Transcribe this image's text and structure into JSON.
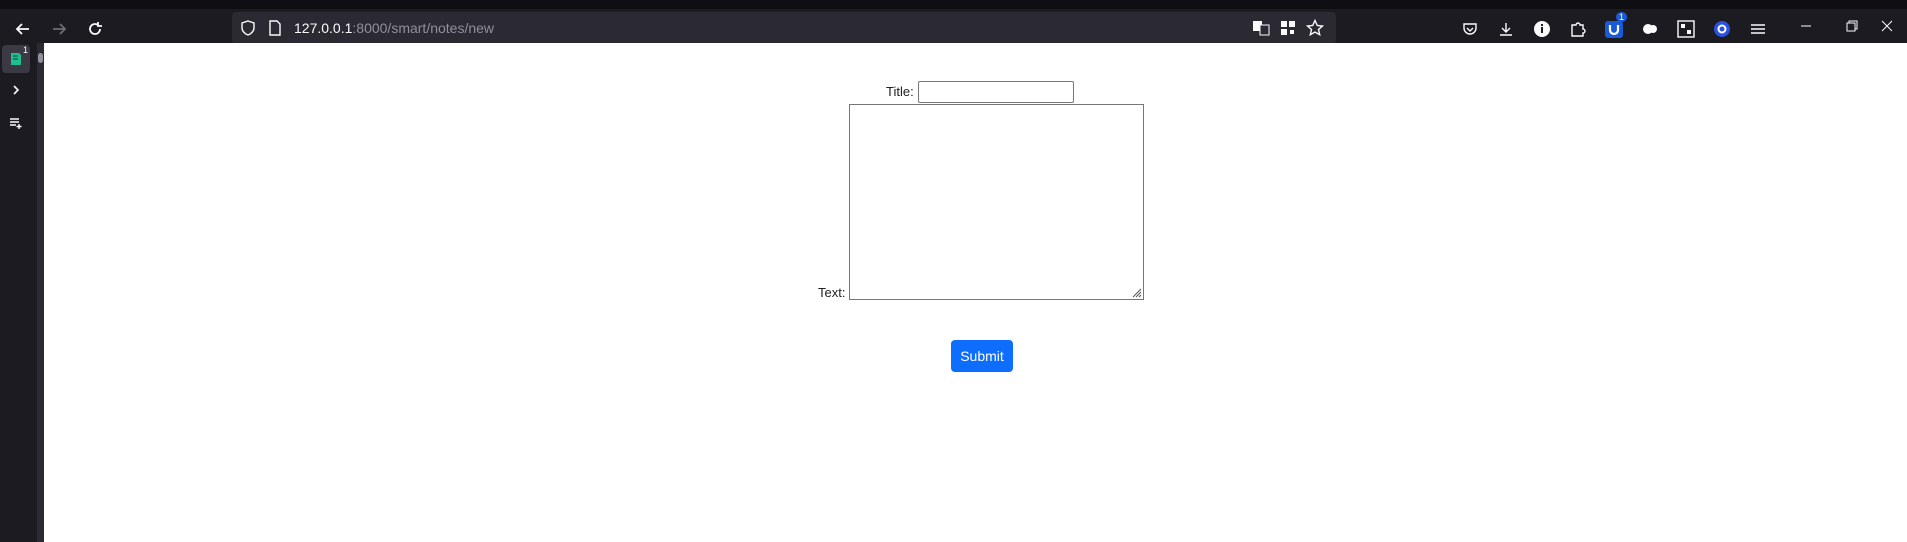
{
  "browser": {
    "url_host": "127.0.0.1",
    "url_rest": ":8000/smart/notes/new",
    "sidebar_badge": "1",
    "ext_badge": "1"
  },
  "form": {
    "title_label": "Title:",
    "title_value": "",
    "text_label": "Text:",
    "text_value": "",
    "submit_label": "Submit"
  },
  "colors": {
    "chrome_bg": "#1c1b22",
    "urlbar_bg": "#2b2a33",
    "submit_bg": "#0d6efd"
  }
}
